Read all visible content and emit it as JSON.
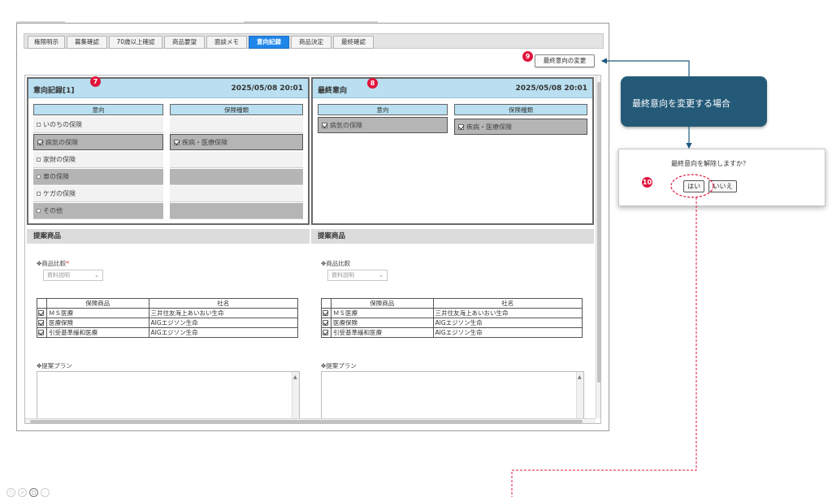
{
  "tabs": [
    {
      "label": "権限明示"
    },
    {
      "label": "募集確認"
    },
    {
      "label": "70歳以上確認"
    },
    {
      "label": "商品要望"
    },
    {
      "label": "面談メモ"
    },
    {
      "label": "意向記録"
    },
    {
      "label": "商品決定"
    },
    {
      "label": "最終確認"
    }
  ],
  "active_tab": "意向記録",
  "change_button": "最終意向の変更",
  "left_panel": {
    "title": "意向記録[1]",
    "date": "2025/05/08 20:01",
    "badge": "7",
    "col_intent": "意向",
    "col_type": "保険種類",
    "intents": [
      {
        "label": "いのちの保険",
        "checked": false,
        "selected": false
      },
      {
        "label": "病気の保険",
        "checked": true,
        "selected": true
      },
      {
        "label": "家財の保険",
        "checked": false,
        "selected": false
      },
      {
        "label": "車の保険",
        "checked": false,
        "selected": true
      },
      {
        "label": "ケガの保険",
        "checked": false,
        "selected": false
      },
      {
        "label": "その他",
        "checked": false,
        "selected": true
      }
    ],
    "types": [
      {
        "label": "",
        "selected": false
      },
      {
        "label": "疾病・医療保険",
        "checked": true,
        "selected": true
      },
      {
        "label": "",
        "selected": false
      },
      {
        "label": "",
        "selected": true
      },
      {
        "label": "",
        "selected": false
      },
      {
        "label": "",
        "selected": true
      }
    ]
  },
  "right_panel": {
    "title": "最終意向",
    "date": "2025/05/08 20:01",
    "badge": "8",
    "col_intent": "意向",
    "col_type": "保険種類",
    "intent": "病気の保険",
    "type": "疾病・医療保険"
  },
  "proposal": {
    "header": "提案商品",
    "compare_label": "✥商品比較",
    "required_mark": "*",
    "select_value": "資料説明",
    "col_product": "保険商品",
    "col_company": "社名",
    "rows": [
      {
        "product": "ＭＳ医療",
        "company": "三井住友海上あいおい生命",
        "checked": true
      },
      {
        "product": "医療保険",
        "company": "AIGエジソン生命",
        "checked": true
      },
      {
        "product": "引受基準緩和医療",
        "company": "AIGエジソン生命",
        "checked": true
      }
    ],
    "plan_label": "✥提案プラン"
  },
  "badge9": "9",
  "callout": "最終意向を変更する場合",
  "dialog": {
    "badge": "10",
    "message": "最終意向を解除しますか？",
    "yes": "はい",
    "no": "いいえ"
  },
  "colors": {
    "active_tab": "#1f86ea",
    "panel_header": "#b9dff0",
    "badge": "#e0143c",
    "callout": "#245a78",
    "connector": "#1e5a7e",
    "dashed": "#e0143c"
  }
}
